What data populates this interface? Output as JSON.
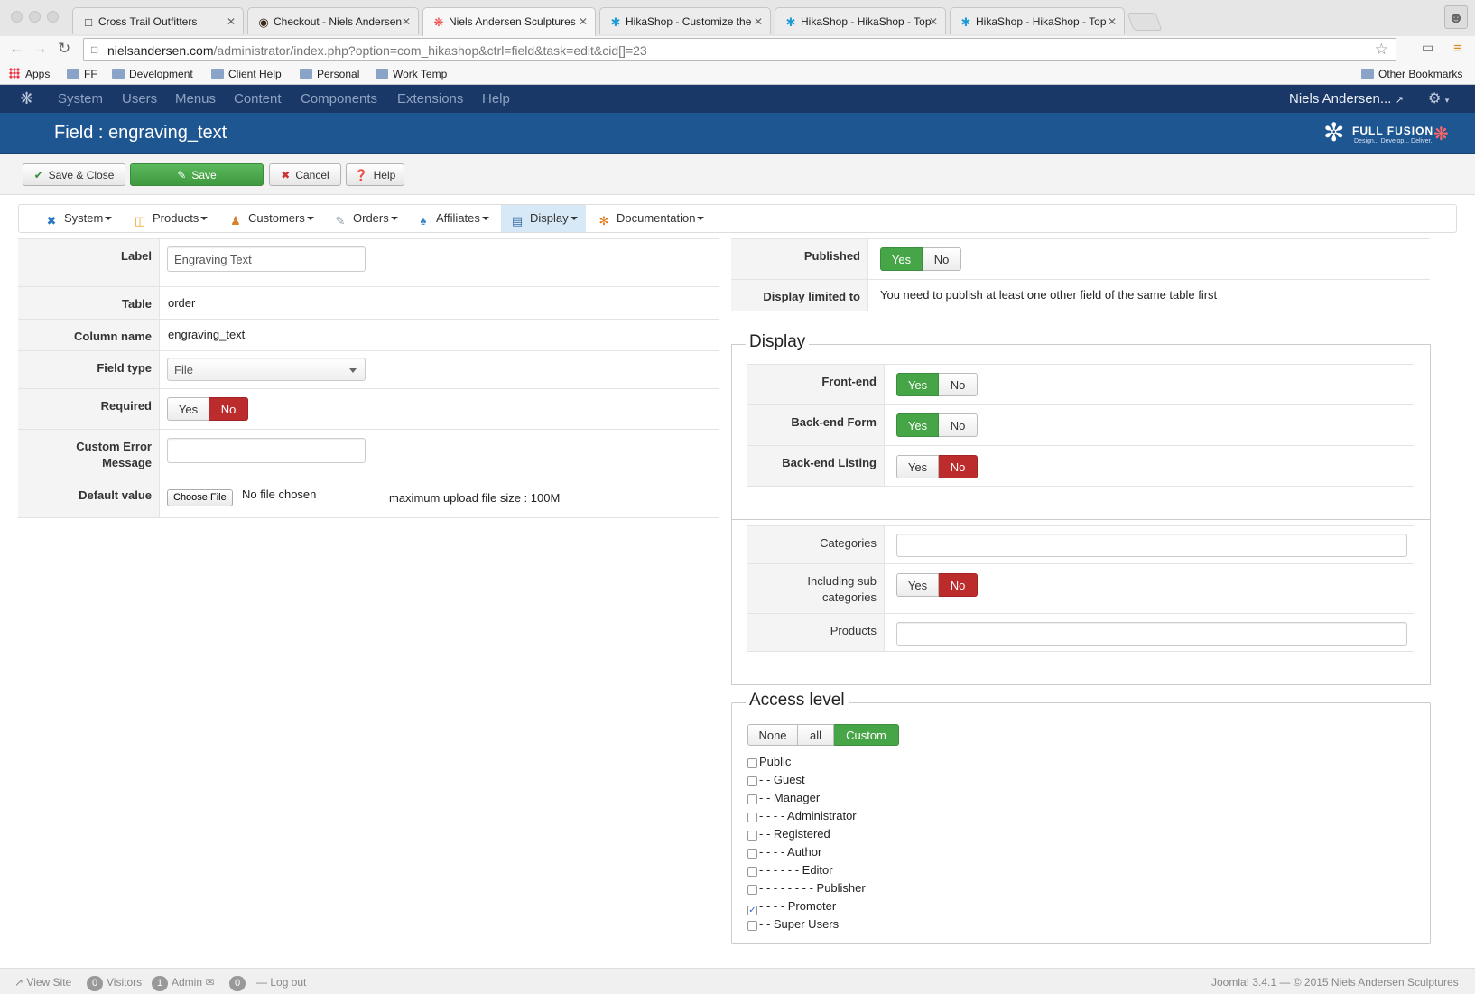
{
  "browser": {
    "tabs": [
      {
        "title": "Cross Trail Outfitters",
        "icon": "page-icon"
      },
      {
        "title": "Checkout - Niels Andersen",
        "icon": "bull-icon"
      },
      {
        "title": "Niels Andersen Sculptures",
        "icon": "joomla-icon",
        "active": true
      },
      {
        "title": "HikaShop - Customize the",
        "icon": "hikashop-icon"
      },
      {
        "title": "HikaShop - HikaShop - Top",
        "icon": "hikashop-icon"
      },
      {
        "title": "HikaShop - HikaShop - Top",
        "icon": "hikashop-icon"
      }
    ],
    "url_host": "nielsandersen.com",
    "url_path": "/administrator/index.php?option=com_hikashop&ctrl=field&task=edit&cid[]=23",
    "bookmarks": [
      "Apps",
      "FF",
      "Development",
      "Client Help",
      "Personal",
      "Work Temp"
    ],
    "other_bookmarks": "Other Bookmarks"
  },
  "admin": {
    "menu": [
      "System",
      "Users",
      "Menus",
      "Content",
      "Components",
      "Extensions",
      "Help"
    ],
    "user": "Niels Andersen...",
    "title": "Field : engraving_text",
    "brand_name": "FULL FUSION",
    "brand_tagline": "Design... Develop... Deliver."
  },
  "toolbar": {
    "save_close": "Save & Close",
    "save": "Save",
    "cancel": "Cancel",
    "help": "Help"
  },
  "hikamenu": [
    "System",
    "Products",
    "Customers",
    "Orders",
    "Affiliates",
    "Display",
    "Documentation"
  ],
  "form": {
    "label_label": "Label",
    "label_value": "Engraving Text",
    "table_label": "Table",
    "table_value": "order",
    "column_label": "Column name",
    "column_value": "engraving_text",
    "fieldtype_label": "Field type",
    "fieldtype_value": "File",
    "required_label": "Required",
    "custom_error_label_1": "Custom Error",
    "custom_error_label_2": "Message",
    "custom_error_value": "",
    "default_label": "Default value",
    "choose_file": "Choose File",
    "no_file": "No file chosen",
    "max_upload": "maximum upload file size : 100M",
    "yes": "Yes",
    "no": "No"
  },
  "right": {
    "published_label": "Published",
    "display_limited_label": "Display limited to",
    "display_limited_value": "You need to publish at least one other field of the same table first",
    "display_legend": "Display",
    "frontend_label": "Front-end",
    "backend_form_label": "Back-end Form",
    "backend_listing_label": "Back-end Listing",
    "categories_label": "Categories",
    "including_sub_1": "Including sub",
    "including_sub_2": "categories",
    "products_label": "Products",
    "access_legend": "Access level",
    "access_none": "None",
    "access_all": "all",
    "access_custom": "Custom",
    "groups": [
      {
        "label": "Public",
        "checked": false
      },
      {
        "label": "- - Guest",
        "checked": false
      },
      {
        "label": "- - Manager",
        "checked": false
      },
      {
        "label": "- - - - Administrator",
        "checked": false
      },
      {
        "label": "- - Registered",
        "checked": false
      },
      {
        "label": "- - - - Author",
        "checked": false
      },
      {
        "label": "- - - - - - Editor",
        "checked": false
      },
      {
        "label": "- - - - - - - - Publisher",
        "checked": false
      },
      {
        "label": "- - - - Promoter",
        "checked": true
      },
      {
        "label": "- - Super Users",
        "checked": false
      }
    ]
  },
  "footer": {
    "view_site": "View Site",
    "visitors_count": "0",
    "visitors": "Visitors",
    "admin_count": "1",
    "admin": "Admin",
    "messages_count": "0",
    "logout": "Log out",
    "version": "Joomla! 3.4.1",
    "copyright": "© 2015 Niels Andersen Sculptures"
  },
  "colors": {
    "admin_bar": "#1a3867",
    "header": "#1e5692",
    "yes_green": "#46a546",
    "no_red": "#bd2c2c"
  }
}
